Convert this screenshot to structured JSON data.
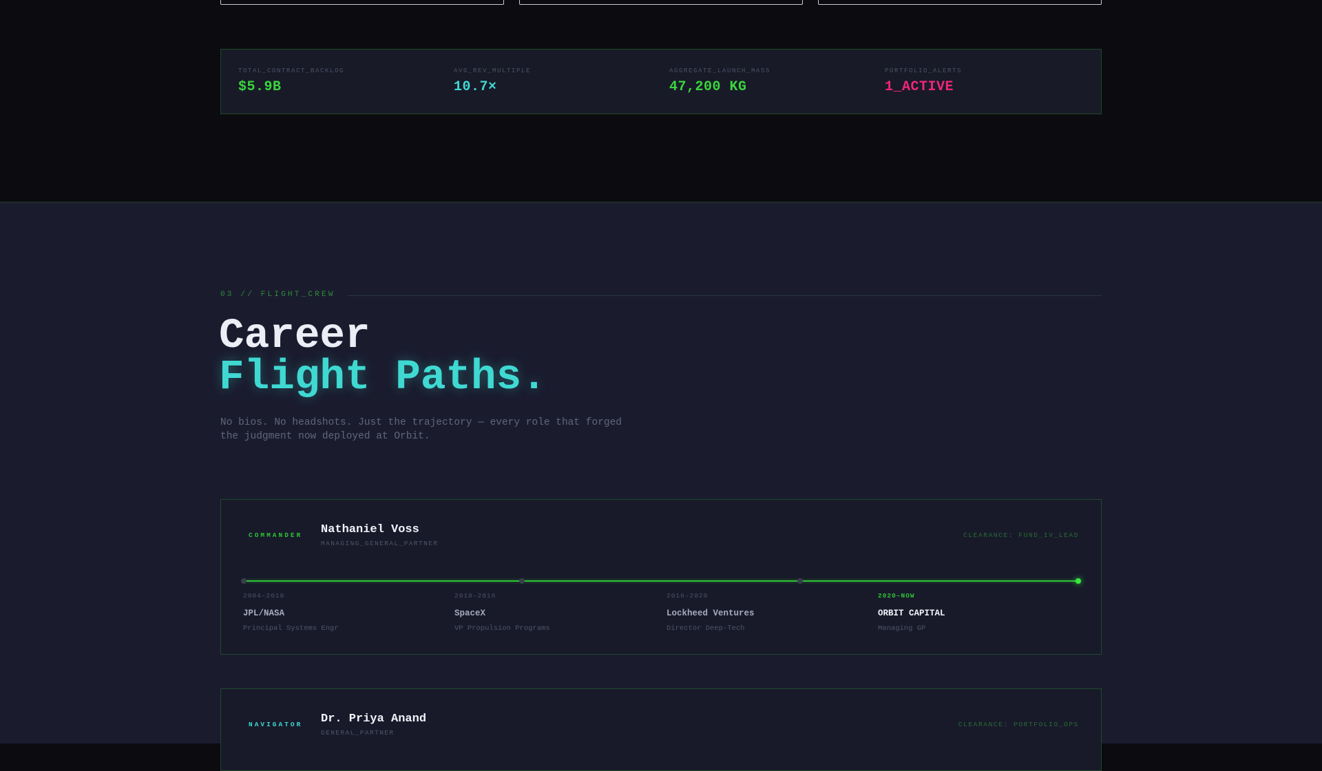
{
  "stats": [
    {
      "label": "TOTAL_CONTRACT_BACKLOG",
      "value": "$5.9B",
      "color": "#39d63d"
    },
    {
      "label": "AVG_REV_MULTIPLE",
      "value": "10.7×",
      "color": "#3fd9d2"
    },
    {
      "label": "AGGREGATE_LAUNCH_MASS",
      "value": "47,200 KG",
      "color": "#39d63d"
    },
    {
      "label": "PORTFOLIO_ALERTS",
      "value": "1_ACTIVE",
      "color": "#f0267a"
    }
  ],
  "section": {
    "eyebrow": "03 // FLIGHT_CREW",
    "title_line1": "Career",
    "title_line2": "Flight Paths.",
    "intro": "No bios. No headshots. Just the trajectory — every role that forged the judgment now deployed at Orbit."
  },
  "crew": [
    {
      "role": "COMMANDER",
      "role_color": "#2ec435",
      "name": "Nathaniel Voss",
      "title": "MANAGING_GENERAL_PARTNER",
      "clearance": "CLEARANCE: FUND_IV_LEAD",
      "stops": [
        {
          "years": "2004–2010",
          "org": "JPL/NASA",
          "role": "Principal Systems Engr"
        },
        {
          "years": "2010–2016",
          "org": "SpaceX",
          "role": "VP Propulsion Programs"
        },
        {
          "years": "2016–2020",
          "org": "Lockheed Ventures",
          "role": "Director Deep-Tech"
        },
        {
          "years": "2020–NOW",
          "org": "ORBIT CAPITAL",
          "role": "Managing GP"
        }
      ]
    },
    {
      "role": "NAVIGATOR",
      "role_color": "#3fd9d2",
      "name": "Dr. Priya Anand",
      "title": "GENERAL_PARTNER",
      "clearance": "CLEARANCE: PORTFOLIO_OPS"
    }
  ]
}
